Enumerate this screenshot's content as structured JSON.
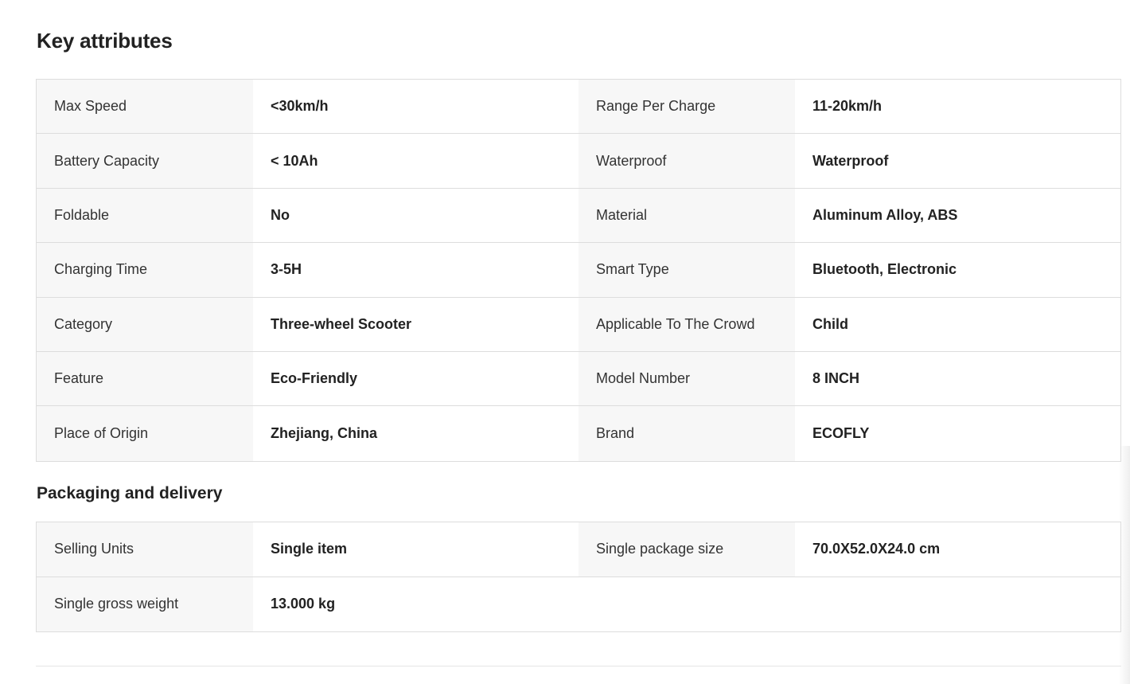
{
  "key_attributes": {
    "title": "Key attributes",
    "rows": [
      [
        {
          "label": "Max Speed",
          "value": "<30km/h"
        },
        {
          "label": "Range Per Charge",
          "value": "11-20km/h"
        }
      ],
      [
        {
          "label": "Battery Capacity",
          "value": "< 10Ah"
        },
        {
          "label": "Waterproof",
          "value": "Waterproof"
        }
      ],
      [
        {
          "label": "Foldable",
          "value": "No"
        },
        {
          "label": "Material",
          "value": "Aluminum Alloy, ABS"
        }
      ],
      [
        {
          "label": "Charging Time",
          "value": "3-5H"
        },
        {
          "label": "Smart Type",
          "value": "Bluetooth, Electronic"
        }
      ],
      [
        {
          "label": "Category",
          "value": "Three-wheel Scooter"
        },
        {
          "label": "Applicable To The Crowd",
          "value": "Child"
        }
      ],
      [
        {
          "label": "Feature",
          "value": "Eco-Friendly"
        },
        {
          "label": "Model Number",
          "value": "8 INCH"
        }
      ],
      [
        {
          "label": "Place of Origin",
          "value": "Zhejiang, China"
        },
        {
          "label": "Brand",
          "value": "ECOFLY"
        }
      ]
    ]
  },
  "packaging": {
    "title": "Packaging and delivery",
    "rows": [
      [
        {
          "label": "Selling Units",
          "value": "Single item"
        },
        {
          "label": "Single package size",
          "value": "70.0X52.0X24.0 cm"
        }
      ],
      [
        {
          "label": "Single gross weight",
          "value": "13.000 kg"
        }
      ]
    ]
  }
}
